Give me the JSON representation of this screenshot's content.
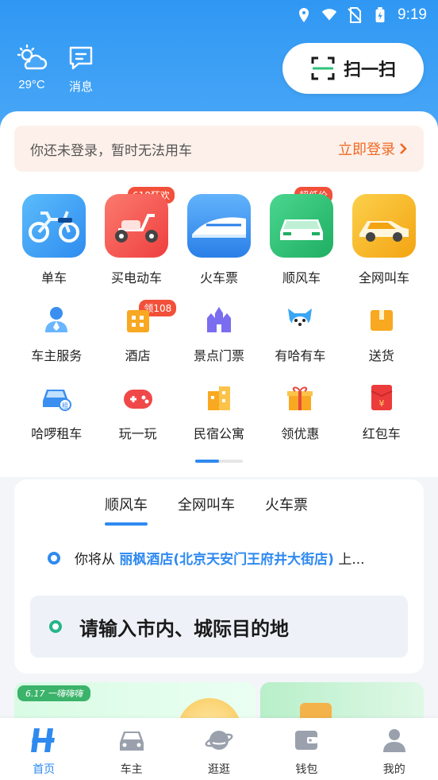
{
  "status_bar": {
    "time": "9:19"
  },
  "header": {
    "weather_temp": "29°C",
    "message_label": "消息",
    "scan_label": "扫一扫"
  },
  "login_bar": {
    "hint": "你还未登录，暂时无法用车",
    "link": "立即登录"
  },
  "big_services": [
    {
      "label": "单车",
      "badge": "",
      "icon": "bicycle-icon",
      "bg": "#3aa6f5"
    },
    {
      "label": "买电动车",
      "badge": "618狂欢",
      "icon": "scooter-icon",
      "bg": "#f65a5a"
    },
    {
      "label": "火车票",
      "badge": "",
      "icon": "train-icon",
      "bg": "#3a8ff0"
    },
    {
      "label": "顺风车",
      "badge": "超低价",
      "icon": "car-green-icon",
      "bg": "#2fc37a"
    },
    {
      "label": "全网叫车",
      "badge": "",
      "icon": "car-yellow-icon",
      "bg": "#f6b727"
    }
  ],
  "small_services": [
    {
      "label": "车主服务",
      "badge": "",
      "icon": "driver-service-icon"
    },
    {
      "label": "酒店",
      "badge": "领108",
      "icon": "hotel-icon"
    },
    {
      "label": "景点门票",
      "badge": "",
      "icon": "castle-icon"
    },
    {
      "label": "有哈有车",
      "badge": "",
      "icon": "mascot-icon"
    },
    {
      "label": "送货",
      "badge": "",
      "icon": "box-icon"
    },
    {
      "label": "哈啰租车",
      "badge": "",
      "icon": "rental-car-icon"
    },
    {
      "label": "玩一玩",
      "badge": "",
      "icon": "gamepad-icon"
    },
    {
      "label": "民宿公寓",
      "badge": "",
      "icon": "apartment-icon"
    },
    {
      "label": "领优惠",
      "badge": "",
      "icon": "gift-icon"
    },
    {
      "label": "红包车",
      "badge": "",
      "icon": "red-envelope-icon"
    }
  ],
  "trip": {
    "tabs": [
      "顺风车",
      "全网叫车",
      "火车票"
    ],
    "active_tab": 0,
    "from_prefix": "你将从",
    "from_place": "丽枫酒店(北京天安门王府井大街店)",
    "from_suffix": "上...",
    "destination_placeholder": "请输入市内、城际目的地"
  },
  "banner": {
    "tag": "6.17 一嗨嗨嗨"
  },
  "bottom_nav": [
    {
      "label": "首页",
      "icon": "home-icon",
      "active": true
    },
    {
      "label": "车主",
      "icon": "car-owner-icon",
      "active": false
    },
    {
      "label": "逛逛",
      "icon": "planet-icon",
      "active": false
    },
    {
      "label": "钱包",
      "icon": "wallet-icon",
      "active": false
    },
    {
      "label": "我的",
      "icon": "profile-icon",
      "active": false
    }
  ],
  "colors": {
    "accent": "#2f8af0",
    "warning": "#f06a23",
    "badge": "#f2503a"
  }
}
